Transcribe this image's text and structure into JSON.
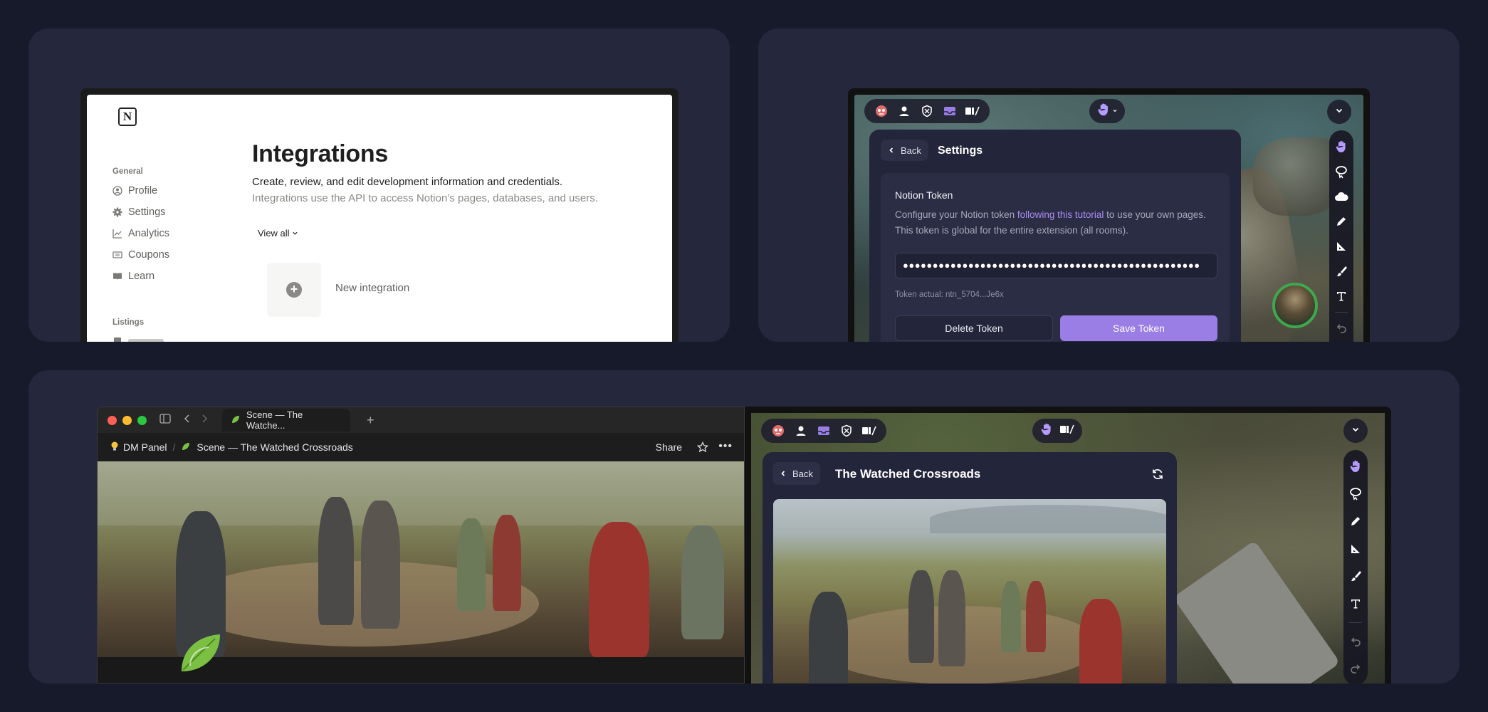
{
  "notion": {
    "section_general": "General",
    "menu": [
      {
        "label": "Profile",
        "icon": "user-circle-icon"
      },
      {
        "label": "Settings",
        "icon": "gear-icon"
      },
      {
        "label": "Analytics",
        "icon": "chart-icon"
      },
      {
        "label": "Coupons",
        "icon": "ticket-icon"
      },
      {
        "label": "Learn",
        "icon": "book-icon"
      }
    ],
    "section_listings": "Listings",
    "title": "Integrations",
    "subtitle": "Create, review, and edit development information and credentials.",
    "subtitle2": "Integrations use the API to access Notion’s pages, databases, and users.",
    "view_all": "View all",
    "new_integration": "New integration"
  },
  "settings": {
    "back": "Back",
    "title": "Settings",
    "token_title": "Notion Token",
    "desc_before": "Configure your Notion token ",
    "desc_link": "following this tutorial",
    "desc_after": " to use your own pages. This token is global for the entire extension (all rooms).",
    "token_value": "●●●●●●●●●●●●●●●●●●●●●●●●●●●●●●●●●●●●●●●●●●●●●●●●●●",
    "token_actual": "Token actual: ntn_5704...Je6x",
    "delete": "Delete Token",
    "save": "Save Token",
    "accent": "#9a7ee6"
  },
  "browser": {
    "tab_title": "Scene — The Watche...",
    "crumb_root": "DM Panel",
    "crumb_page": "Scene — The Watched Crossroads",
    "share": "Share"
  },
  "scene": {
    "back": "Back",
    "title": "The Watched Crossroads"
  }
}
